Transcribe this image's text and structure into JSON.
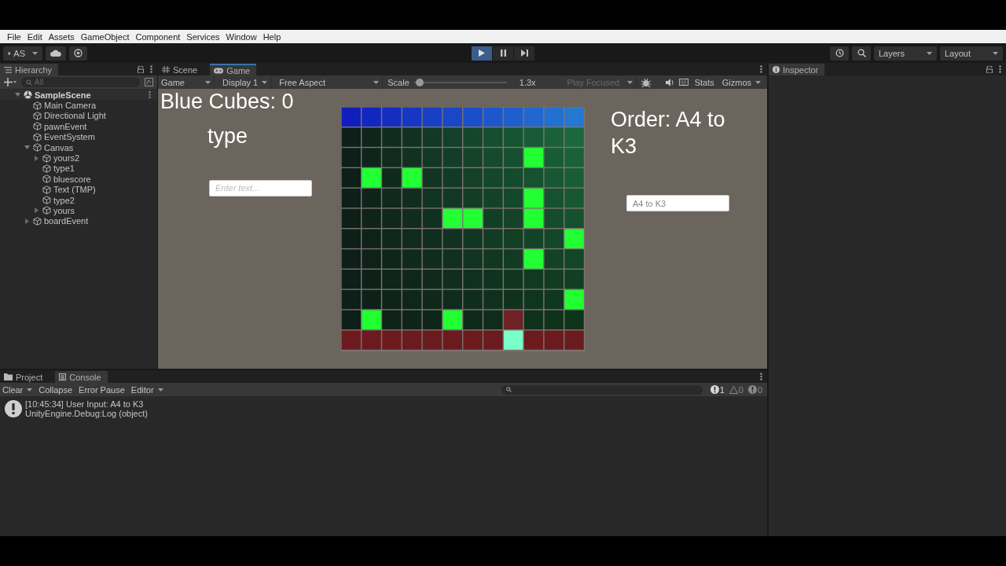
{
  "menu": [
    "File",
    "Edit",
    "Assets",
    "GameObject",
    "Component",
    "Services",
    "Window",
    "Help"
  ],
  "toolbar": {
    "account": "AS",
    "play": {
      "playing": true
    },
    "pause": {
      "paused": false
    },
    "layers": "Layers",
    "layout": "Layout"
  },
  "hierarchy": {
    "tab": "Hierarchy",
    "search_placeholder": "All",
    "tree": [
      {
        "label": "SampleScene",
        "kind": "scene",
        "expanded": true,
        "children": [
          {
            "label": "Main Camera",
            "kind": "object",
            "expanded": false
          },
          {
            "label": "Directional Light",
            "kind": "object",
            "expanded": false
          },
          {
            "label": "pawnEvent",
            "kind": "object",
            "expanded": false
          },
          {
            "label": "EventSystem",
            "kind": "object",
            "expanded": false
          },
          {
            "label": "Canvas",
            "kind": "parent",
            "expanded": true,
            "children": [
              {
                "label": "yours2",
                "kind": "parent",
                "expanded": false
              },
              {
                "label": "type1",
                "kind": "object",
                "expanded": false
              },
              {
                "label": "bluescore",
                "kind": "object",
                "expanded": false
              },
              {
                "label": "Text (TMP)",
                "kind": "object",
                "expanded": false
              },
              {
                "label": "type2",
                "kind": "object",
                "expanded": false
              },
              {
                "label": "yours",
                "kind": "parent",
                "expanded": false
              }
            ]
          },
          {
            "label": "boardEvent",
            "kind": "parent",
            "expanded": false
          }
        ]
      }
    ]
  },
  "view_tabs": [
    {
      "label": "Scene",
      "selected": false
    },
    {
      "label": "Game",
      "selected": true
    }
  ],
  "game_toolbar": {
    "view": "Game",
    "display": "Display 1",
    "aspect": "Free Aspect",
    "scale_label": "Scale",
    "scale": {
      "level": 0.02
    },
    "scale_value": "1.3x",
    "play_mode": "Play Focused",
    "stats": "Stats",
    "gizmos": "Gizmos"
  },
  "game": {
    "score": "Blue Cubes: 0",
    "type_label": "type",
    "left_input": {
      "placeholder": "Enter text..."
    },
    "order": "Order: A4 to K3",
    "right_input": {
      "value": "A4 to K3"
    },
    "board": [
      [
        {
          "kind": "blue"
        },
        {
          "kind": "blue"
        },
        {
          "kind": "blue"
        },
        {
          "kind": "blue"
        },
        {
          "kind": "blue"
        },
        {
          "kind": "blue"
        },
        {
          "kind": "blue"
        },
        {
          "kind": "blue"
        },
        {
          "kind": "blue"
        },
        {
          "kind": "blue"
        },
        {
          "kind": "blue"
        },
        {
          "kind": "blue"
        }
      ],
      [
        {
          "kind": "tile"
        },
        {
          "kind": "tile"
        },
        {
          "kind": "tile"
        },
        {
          "kind": "tile"
        },
        {
          "kind": "tile"
        },
        {
          "kind": "tile"
        },
        {
          "kind": "tile"
        },
        {
          "kind": "tile"
        },
        {
          "kind": "tile"
        },
        {
          "kind": "tile"
        },
        {
          "kind": "tile"
        },
        {
          "kind": "tile"
        }
      ],
      [
        {
          "kind": "tile"
        },
        {
          "kind": "tile"
        },
        {
          "kind": "tile"
        },
        {
          "kind": "tile"
        },
        {
          "kind": "tile"
        },
        {
          "kind": "tile"
        },
        {
          "kind": "tile"
        },
        {
          "kind": "tile"
        },
        {
          "kind": "tile"
        },
        {
          "kind": "lit"
        },
        {
          "kind": "tile"
        },
        {
          "kind": "tile"
        }
      ],
      [
        {
          "kind": "tile"
        },
        {
          "kind": "lit"
        },
        {
          "kind": "tile"
        },
        {
          "kind": "lit"
        },
        {
          "kind": "tile"
        },
        {
          "kind": "tile"
        },
        {
          "kind": "tile"
        },
        {
          "kind": "tile"
        },
        {
          "kind": "tile"
        },
        {
          "kind": "tile"
        },
        {
          "kind": "tile"
        },
        {
          "kind": "tile"
        }
      ],
      [
        {
          "kind": "tile"
        },
        {
          "kind": "tile"
        },
        {
          "kind": "tile"
        },
        {
          "kind": "tile"
        },
        {
          "kind": "tile"
        },
        {
          "kind": "tile"
        },
        {
          "kind": "tile"
        },
        {
          "kind": "tile"
        },
        {
          "kind": "tile"
        },
        {
          "kind": "lit"
        },
        {
          "kind": "tile"
        },
        {
          "kind": "tile"
        }
      ],
      [
        {
          "kind": "tile"
        },
        {
          "kind": "tile"
        },
        {
          "kind": "tile"
        },
        {
          "kind": "tile"
        },
        {
          "kind": "tile"
        },
        {
          "kind": "lit"
        },
        {
          "kind": "lit"
        },
        {
          "kind": "tile"
        },
        {
          "kind": "tile"
        },
        {
          "kind": "lit"
        },
        {
          "kind": "tile"
        },
        {
          "kind": "tile"
        }
      ],
      [
        {
          "kind": "tile"
        },
        {
          "kind": "tile"
        },
        {
          "kind": "tile"
        },
        {
          "kind": "tile"
        },
        {
          "kind": "tile"
        },
        {
          "kind": "tile"
        },
        {
          "kind": "tile"
        },
        {
          "kind": "tile"
        },
        {
          "kind": "tile"
        },
        {
          "kind": "tile"
        },
        {
          "kind": "tile"
        },
        {
          "kind": "lit"
        }
      ],
      [
        {
          "kind": "tile"
        },
        {
          "kind": "tile"
        },
        {
          "kind": "tile"
        },
        {
          "kind": "tile"
        },
        {
          "kind": "tile"
        },
        {
          "kind": "tile"
        },
        {
          "kind": "tile"
        },
        {
          "kind": "tile"
        },
        {
          "kind": "tile"
        },
        {
          "kind": "lit"
        },
        {
          "kind": "tile"
        },
        {
          "kind": "tile"
        }
      ],
      [
        {
          "kind": "tile"
        },
        {
          "kind": "tile"
        },
        {
          "kind": "tile"
        },
        {
          "kind": "tile"
        },
        {
          "kind": "tile"
        },
        {
          "kind": "tile"
        },
        {
          "kind": "tile"
        },
        {
          "kind": "tile"
        },
        {
          "kind": "tile"
        },
        {
          "kind": "tile"
        },
        {
          "kind": "tile"
        },
        {
          "kind": "tile"
        }
      ],
      [
        {
          "kind": "tile"
        },
        {
          "kind": "tile"
        },
        {
          "kind": "tile"
        },
        {
          "kind": "tile"
        },
        {
          "kind": "tile"
        },
        {
          "kind": "tile"
        },
        {
          "kind": "tile"
        },
        {
          "kind": "tile"
        },
        {
          "kind": "tile"
        },
        {
          "kind": "tile"
        },
        {
          "kind": "tile"
        },
        {
          "kind": "lit"
        }
      ],
      [
        {
          "kind": "tile"
        },
        {
          "kind": "lit"
        },
        {
          "kind": "tile"
        },
        {
          "kind": "tile"
        },
        {
          "kind": "tile"
        },
        {
          "kind": "lit"
        },
        {
          "kind": "tile"
        },
        {
          "kind": "tile"
        },
        {
          "kind": "wine"
        },
        {
          "kind": "tile"
        },
        {
          "kind": "tile"
        },
        {
          "kind": "tile"
        }
      ],
      [
        {
          "kind": "red"
        },
        {
          "kind": "red"
        },
        {
          "kind": "red"
        },
        {
          "kind": "red"
        },
        {
          "kind": "red"
        },
        {
          "kind": "red"
        },
        {
          "kind": "red"
        },
        {
          "kind": "red"
        },
        {
          "kind": "mint"
        },
        {
          "kind": "red"
        },
        {
          "kind": "red"
        },
        {
          "kind": "red"
        }
      ]
    ]
  },
  "inspector": {
    "tab": "Inspector"
  },
  "bottom_tabs": [
    {
      "label": "Project",
      "selected": false
    },
    {
      "label": "Console",
      "selected": true
    }
  ],
  "console": {
    "clear": "Clear",
    "collapse": "Collapse",
    "error_pause": "Error Pause",
    "editor": "Editor",
    "counts": [
      {
        "kind": "info",
        "count": "1"
      },
      {
        "kind": "warning",
        "count": "0"
      },
      {
        "kind": "error",
        "count": "0"
      }
    ],
    "log": [
      {
        "kind": "info",
        "line1": "[10:45:34] User Input: A4 to K3",
        "line2": "UnityEngine.Debug:Log (object)"
      }
    ]
  }
}
